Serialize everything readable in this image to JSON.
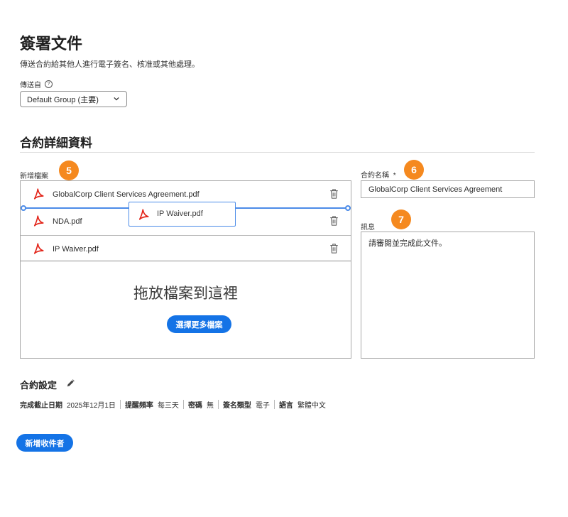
{
  "header": {
    "title": "簽署文件",
    "subtitle": "傳送合約給其他人進行電子簽名、核准或其他處理。"
  },
  "sender": {
    "label": "傳送自",
    "help_icon": "?",
    "selected": "Default Group (主要)"
  },
  "section": {
    "title": "合約詳細資料"
  },
  "files": {
    "label": "新增檔案",
    "badge": "5",
    "items": [
      {
        "name": "GlobalCorp Client Services Agreement.pdf"
      },
      {
        "name": "NDA.pdf"
      },
      {
        "name": "IP Waiver.pdf"
      }
    ],
    "dragging": {
      "name": "IP Waiver.pdf"
    },
    "drop_text": "拖放檔案到這裡",
    "choose_more_label": "選擇更多檔案"
  },
  "agreement_name": {
    "label": "合約名稱",
    "required_mark": "*",
    "badge": "6",
    "value": "GlobalCorp Client Services Agreement"
  },
  "message": {
    "label": "訊息",
    "badge": "7",
    "value": "請審閱並完成此文件。"
  },
  "settings": {
    "title": "合約設定",
    "items": [
      {
        "key": "完成截止日期",
        "value": "2025年12月1日"
      },
      {
        "key": "提醒頻率",
        "value": "每三天"
      },
      {
        "key": "密碼",
        "value": "無"
      },
      {
        "key": "簽名類型",
        "value": "電子"
      },
      {
        "key": "語言",
        "value": "繁體中文"
      }
    ]
  },
  "add_recipient_label": "新增收件者",
  "colors": {
    "accent_blue": "#1473e6",
    "badge_orange": "#f5891f",
    "pdf_red": "#e3261b"
  },
  "icons": {
    "pdf": "pdf-icon",
    "trash": "trash-icon",
    "pencil": "pencil-icon",
    "chevron": "chevron-down-icon",
    "help": "help-icon"
  }
}
